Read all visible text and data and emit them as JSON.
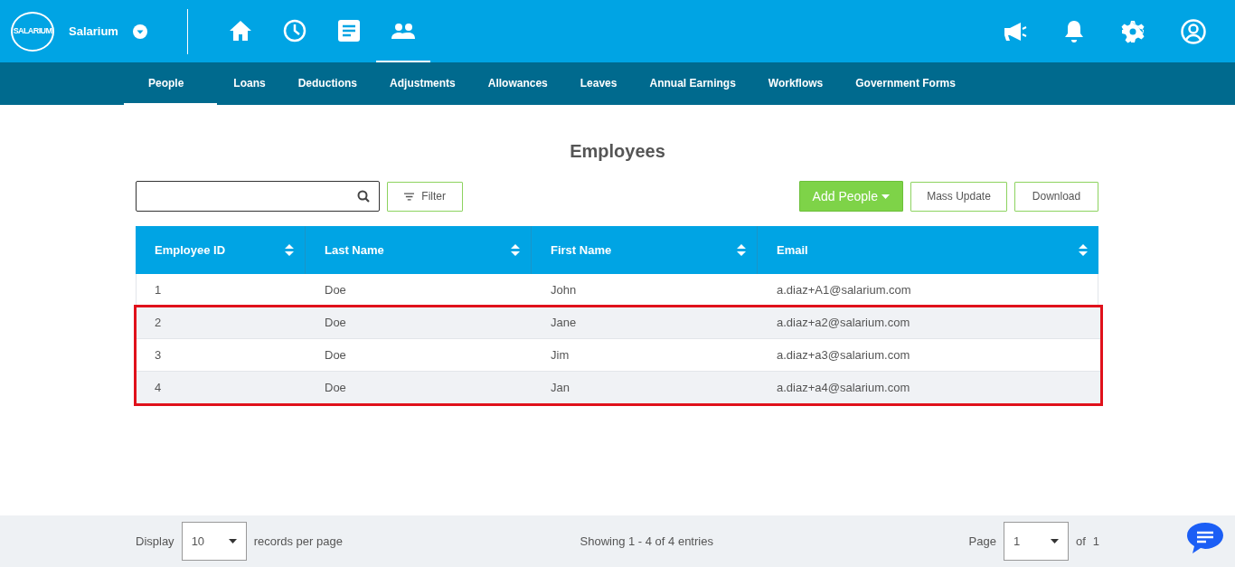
{
  "brand": {
    "logo_text": "SALARIUM",
    "name": "Salarium"
  },
  "main_nav": [
    {
      "kind": "home",
      "selected": false
    },
    {
      "kind": "clock",
      "selected": false
    },
    {
      "kind": "document",
      "selected": false
    },
    {
      "kind": "people",
      "selected": true
    }
  ],
  "header_actions": [
    {
      "kind": "megaphone"
    },
    {
      "kind": "bell"
    },
    {
      "kind": "gear"
    },
    {
      "kind": "user"
    }
  ],
  "sub_nav": [
    {
      "label": "People",
      "selected": true
    },
    {
      "label": "Loans",
      "selected": false
    },
    {
      "label": "Deductions",
      "selected": false
    },
    {
      "label": "Adjustments",
      "selected": false
    },
    {
      "label": "Allowances",
      "selected": false
    },
    {
      "label": "Leaves",
      "selected": false
    },
    {
      "label": "Annual Earnings",
      "selected": false
    },
    {
      "label": "Workflows",
      "selected": false
    },
    {
      "label": "Government Forms",
      "selected": false
    }
  ],
  "page_title": "Employees",
  "toolbar": {
    "filter": "Filter",
    "add": "Add People",
    "mass_update": "Mass Update",
    "download": "Download"
  },
  "table": {
    "columns": [
      "Employee ID",
      "Last Name",
      "First Name",
      "Email"
    ],
    "rows": [
      {
        "cells": [
          "1",
          "Doe",
          "John",
          "a.diaz+A1@salarium.com"
        ],
        "highlighted": false
      },
      {
        "cells": [
          "2",
          "Doe",
          "Jane",
          "a.diaz+a2@salarium.com"
        ],
        "highlighted": true
      },
      {
        "cells": [
          "3",
          "Doe",
          "Jim",
          "a.diaz+a3@salarium.com"
        ],
        "highlighted": true
      },
      {
        "cells": [
          "4",
          "Doe",
          "Jan",
          "a.diaz+a4@salarium.com"
        ],
        "highlighted": true
      }
    ]
  },
  "footer": {
    "display_label": "Display",
    "page_size": "10",
    "per_page_label": "records per page",
    "summary": "Showing 1 - 4 of 4 entries",
    "page_label": "Page",
    "page": "1",
    "of_label": "of",
    "total_pages": "1"
  }
}
